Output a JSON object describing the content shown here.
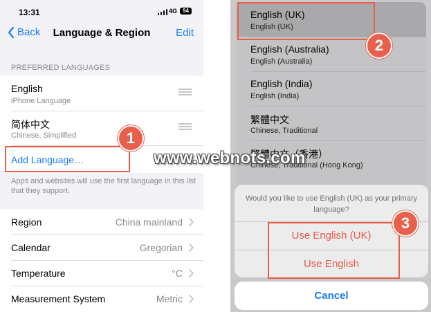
{
  "left": {
    "status_bar": {
      "time": "13:31",
      "network": "4G",
      "battery": "94"
    },
    "nav": {
      "back_label": "Back",
      "title": "Language & Region",
      "edit_label": "Edit"
    },
    "preferred_header": "PREFERRED LANGUAGES",
    "languages": [
      {
        "name": "English",
        "subtitle": "iPhone Language"
      },
      {
        "name": "简体中文",
        "subtitle": "Chinese, Simplified"
      }
    ],
    "add_language": "Add Language…",
    "footer_note": "Apps and websites will use the first language in this list that they support.",
    "settings": [
      {
        "label": "Region",
        "value": "China mainland"
      },
      {
        "label": "Calendar",
        "value": "Gregorian"
      },
      {
        "label": "Temperature",
        "value": "°C"
      },
      {
        "label": "Measurement System",
        "value": "Metric"
      }
    ]
  },
  "right": {
    "language_list": [
      {
        "name": "English (UK)",
        "subtitle": "English (UK)"
      },
      {
        "name": "English (Australia)",
        "subtitle": "English (Australia)"
      },
      {
        "name": "English (India)",
        "subtitle": "English (India)"
      },
      {
        "name": "繁體中文",
        "subtitle": "Chinese, Traditional"
      },
      {
        "name": "繁體中文（香港）",
        "subtitle": "Chinese, Traditional (Hong Kong)"
      }
    ],
    "alert": {
      "message": "Would you like to use English (UK) as your primary language?",
      "option_1": "Use English (UK)",
      "option_2": "Use English"
    },
    "cancel_label": "Cancel"
  },
  "annotations": {
    "step_1": "1",
    "step_2": "2",
    "step_3": "3",
    "accent_color": "#e8604c"
  },
  "watermark": "www.webnots.com"
}
